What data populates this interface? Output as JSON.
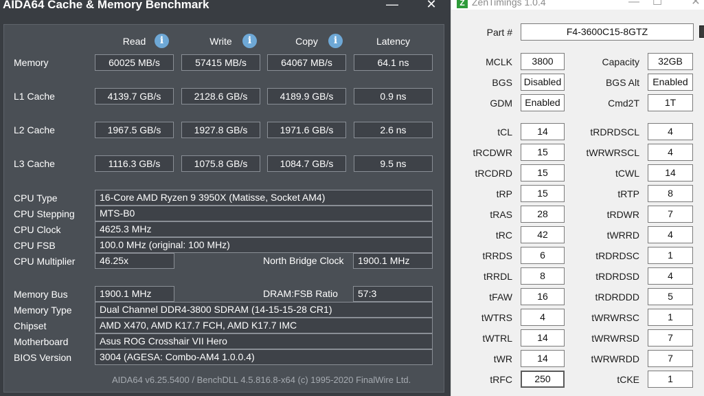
{
  "aida": {
    "title": "AIDA64 Cache & Memory Benchmark",
    "window_controls": {
      "minimize": "—",
      "close": "✕"
    },
    "columns": {
      "read": "Read",
      "write": "Write",
      "copy": "Copy",
      "latency": "Latency"
    },
    "bench_rows": [
      {
        "label": "Memory",
        "read": "60025 MB/s",
        "write": "57415 MB/s",
        "copy": "64067 MB/s",
        "latency": "64.1 ns"
      },
      {
        "label": "L1 Cache",
        "read": "4139.7 GB/s",
        "write": "2128.6 GB/s",
        "copy": "4189.9 GB/s",
        "latency": "0.9 ns"
      },
      {
        "label": "L2 Cache",
        "read": "1967.5 GB/s",
        "write": "1927.8 GB/s",
        "copy": "1971.6 GB/s",
        "latency": "2.6 ns"
      },
      {
        "label": "L3 Cache",
        "read": "1116.3 GB/s",
        "write": "1075.8 GB/s",
        "copy": "1084.7 GB/s",
        "latency": "9.5 ns"
      }
    ],
    "cpu": {
      "type_label": "CPU Type",
      "type": "16-Core AMD Ryzen 9 3950X  (Matisse, Socket AM4)",
      "stepping_label": "CPU Stepping",
      "stepping": "MTS-B0",
      "clock_label": "CPU Clock",
      "clock": "4625.3 MHz",
      "fsb_label": "CPU FSB",
      "fsb": "100.0 MHz  (original: 100 MHz)",
      "multiplier_label": "CPU Multiplier",
      "multiplier": "46.25x",
      "nb_clock_label": "North Bridge Clock",
      "nb_clock": "1900.1 MHz"
    },
    "memory": {
      "bus_label": "Memory Bus",
      "bus": "1900.1 MHz",
      "ratio_label": "DRAM:FSB Ratio",
      "ratio": "57:3",
      "type_label": "Memory Type",
      "type": "Dual Channel DDR4-3800 SDRAM  (14-15-15-28 CR1)",
      "chipset_label": "Chipset",
      "chipset": "AMD X470, AMD K17.7 FCH, AMD K17.7 IMC",
      "motherboard_label": "Motherboard",
      "motherboard": "Asus ROG Crosshair VII Hero",
      "bios_label": "BIOS Version",
      "bios": "3004  (AGESA: Combo-AM4 1.0.0.4)"
    },
    "footer": "AIDA64 v6.25.5400 / BenchDLL 4.5.816.8-x64  (c) 1995-2020 FinalWire Ltd."
  },
  "zen": {
    "logo": "Z",
    "title": "ZenTimings 1.0.4",
    "window_controls": {
      "minimize": "—",
      "maximize": "☐",
      "close": "✕"
    },
    "part_label": "Part #",
    "part": "F4-3600C15-8GTZ",
    "top_left": [
      {
        "label": "MCLK",
        "value": "3800"
      },
      {
        "label": "BGS",
        "value": "Disabled"
      },
      {
        "label": "GDM",
        "value": "Enabled"
      }
    ],
    "top_right": [
      {
        "label": "Capacity",
        "value": "32GB"
      },
      {
        "label": "BGS Alt",
        "value": "Enabled"
      },
      {
        "label": "Cmd2T",
        "value": "1T"
      }
    ],
    "left_timings": [
      {
        "label": "tCL",
        "value": "14"
      },
      {
        "label": "tRCDWR",
        "value": "15"
      },
      {
        "label": "tRCDRD",
        "value": "15"
      },
      {
        "label": "tRP",
        "value": "15"
      },
      {
        "label": "tRAS",
        "value": "28"
      },
      {
        "label": "tRC",
        "value": "42"
      },
      {
        "label": "tRRDS",
        "value": "6"
      },
      {
        "label": "tRRDL",
        "value": "8"
      },
      {
        "label": "tFAW",
        "value": "16"
      },
      {
        "label": "tWTRS",
        "value": "4"
      },
      {
        "label": "tWTRL",
        "value": "14"
      },
      {
        "label": "tWR",
        "value": "14"
      },
      {
        "label": "tRFC",
        "value": "250"
      }
    ],
    "right_timings": [
      {
        "label": "tRDRDSCL",
        "value": "4"
      },
      {
        "label": "tWRWRSCL",
        "value": "4"
      },
      {
        "label": "tCWL",
        "value": "14"
      },
      {
        "label": "tRTP",
        "value": "8"
      },
      {
        "label": "tRDWR",
        "value": "7"
      },
      {
        "label": "tWRRD",
        "value": "4"
      },
      {
        "label": "tRDRDSC",
        "value": "1"
      },
      {
        "label": "tRDRDSD",
        "value": "4"
      },
      {
        "label": "tRDRDDD",
        "value": "5"
      },
      {
        "label": "tWRWRSC",
        "value": "1"
      },
      {
        "label": "tWRWRSD",
        "value": "7"
      },
      {
        "label": "tWRWRDD",
        "value": "7"
      },
      {
        "label": "tCKE",
        "value": "1"
      }
    ]
  }
}
